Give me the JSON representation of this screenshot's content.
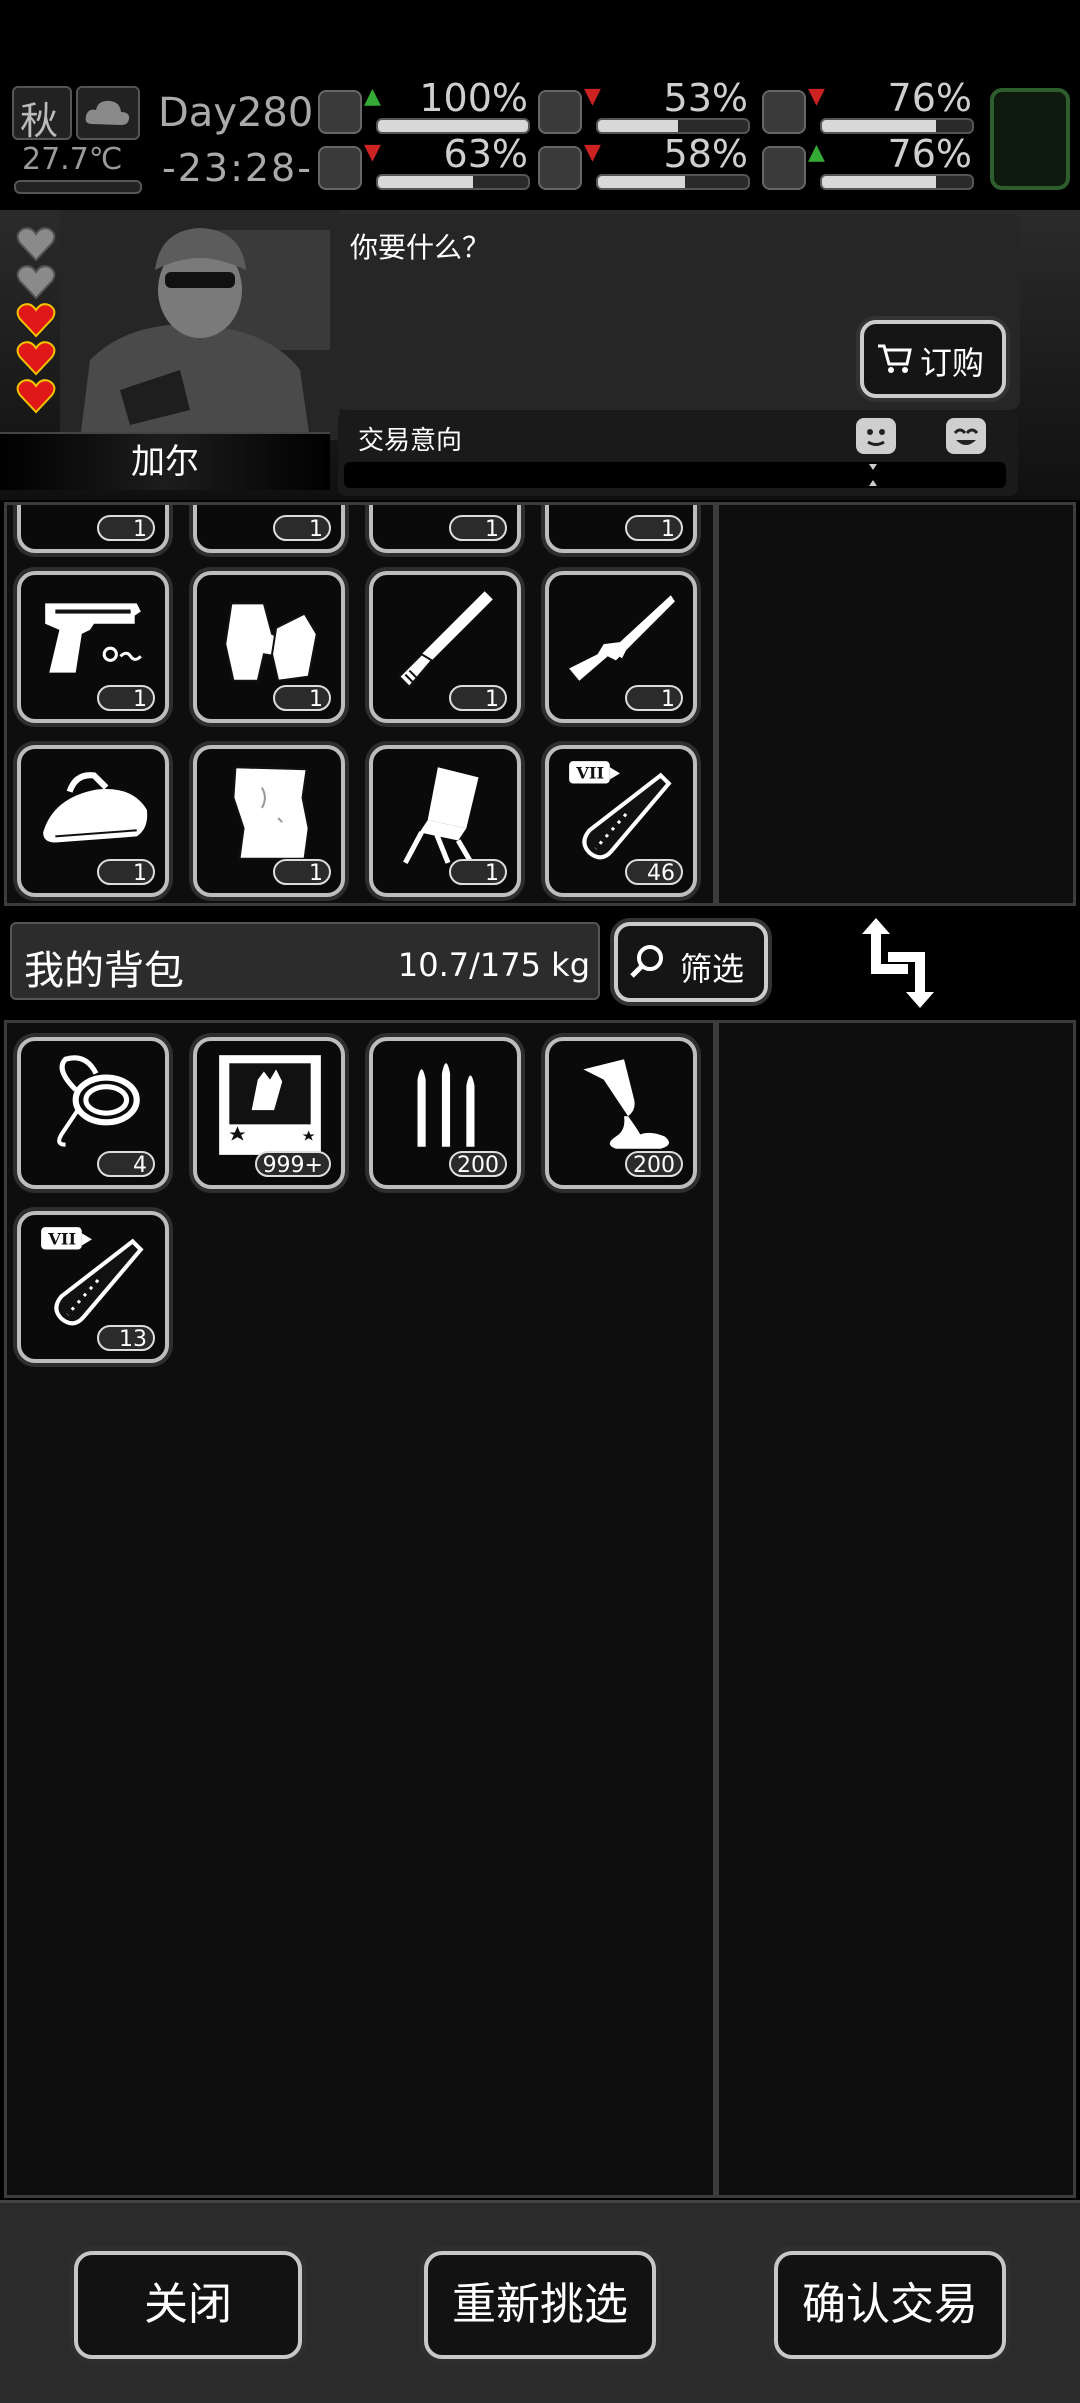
{
  "status": {
    "season": "秋",
    "temperature": "27.7℃",
    "day": "Day280",
    "time": "-23:28-",
    "stats": [
      {
        "name": "health",
        "icon": "medkit-icon",
        "value": "100%",
        "level": 1.0,
        "trend": "up"
      },
      {
        "name": "hunger",
        "icon": "stomach-icon",
        "value": "53%",
        "level": 0.53,
        "trend": "down"
      },
      {
        "name": "mood",
        "icon": "brain-icon",
        "value": "76%",
        "level": 0.76,
        "trend": "down"
      },
      {
        "name": "stamina",
        "icon": "boot-icon",
        "value": "63%",
        "level": 0.63,
        "trend": "down"
      },
      {
        "name": "thirst",
        "icon": "water-drop-icon",
        "value": "58%",
        "level": 0.58,
        "trend": "down"
      },
      {
        "name": "heart",
        "icon": "heart-icon",
        "value": "76%",
        "level": 0.76,
        "trend": "up"
      }
    ]
  },
  "npc": {
    "name": "加尔",
    "hearts_filled": 3,
    "hearts_total": 5,
    "dialogue": "你要什么？",
    "order_button": "订购",
    "trade_intent_label": "交易意向"
  },
  "trader_items": [
    {
      "icon": "pistol-icon",
      "count": "1"
    },
    {
      "icon": "gloves-icon",
      "count": "1"
    },
    {
      "icon": "machete-icon",
      "count": "1"
    },
    {
      "icon": "rifle-icon",
      "count": "1"
    },
    {
      "icon": "iron-icon",
      "count": "1"
    },
    {
      "icon": "paper-icon",
      "count": "1"
    },
    {
      "icon": "folding-chair-icon",
      "count": "1"
    },
    {
      "icon": "test-tube-icon",
      "count": "46"
    }
  ],
  "trader_top_counts": [
    "1",
    "1",
    "1",
    "1"
  ],
  "backpack": {
    "title": "我的背包",
    "weight": "10.7/175 kg",
    "filter_button": "筛选",
    "items": [
      {
        "icon": "rope-icon",
        "count": "4"
      },
      {
        "icon": "zombie-card-icon",
        "count": "999+"
      },
      {
        "icon": "bullets-icon",
        "count": "200"
      },
      {
        "icon": "glue-icon",
        "count": "200"
      },
      {
        "icon": "test-tube-icon",
        "count": "13"
      }
    ]
  },
  "buttons": {
    "close": "关闭",
    "reselect": "重新挑选",
    "confirm": "确认交易"
  }
}
